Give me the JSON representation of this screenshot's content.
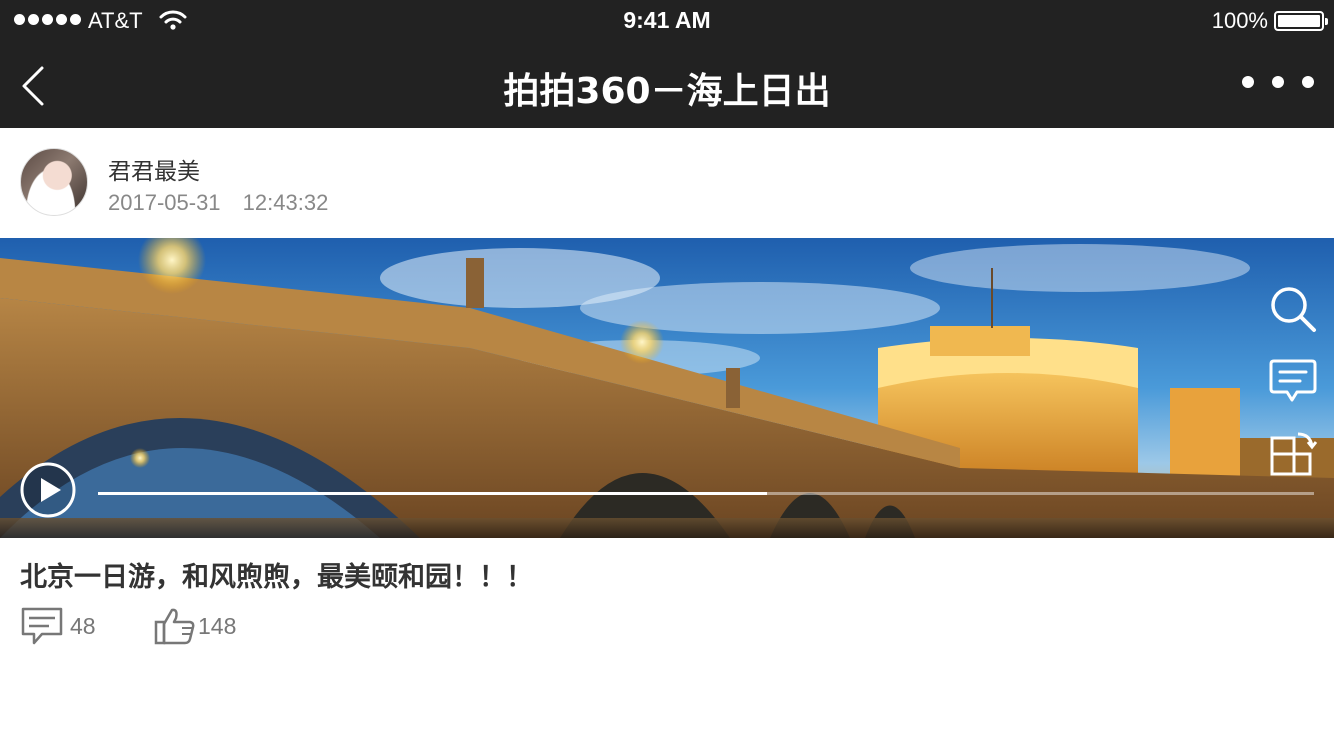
{
  "status_bar": {
    "carrier": "AT&T",
    "time": "9:41 AM",
    "battery": "100%",
    "battery_level": 1.0
  },
  "nav": {
    "title": "拍拍360－海上日出",
    "back_icon": "chevron-left-icon",
    "more_icon": "more-dots-icon"
  },
  "author": {
    "name": "君君最美",
    "date": "2017-05-31",
    "time": "12:43:32"
  },
  "media": {
    "progress": 0.55,
    "icons": [
      "search-icon",
      "comment-icon",
      "rotate-icon",
      "play-icon"
    ]
  },
  "post": {
    "caption": "北京一日游，和风煦煦，最美颐和园！！！",
    "comment_count": "48",
    "like_count": "148"
  },
  "colors": {
    "bar_bg": "#222222",
    "text": "#333333",
    "muted": "#888888"
  }
}
